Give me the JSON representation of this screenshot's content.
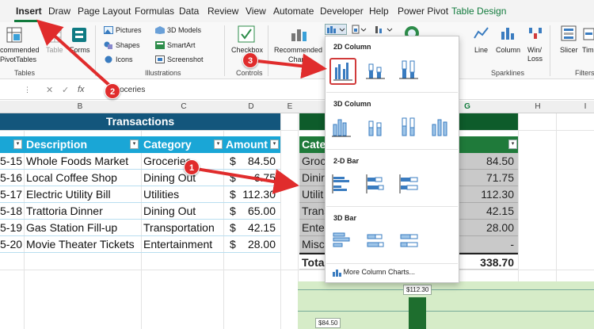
{
  "menu": {
    "tabs": [
      "Insert",
      "Draw",
      "Page Layout",
      "Formulas",
      "Data",
      "Review",
      "View",
      "Automate",
      "Developer",
      "Help",
      "Power Pivot",
      "Table Design"
    ]
  },
  "ribbon": {
    "tables": {
      "recommended": "commended",
      "pivottables": "PivotTables",
      "table": "Table",
      "forms": "Forms",
      "group_label": "Tables"
    },
    "illustrations": {
      "pictures": "Pictures",
      "shapes": "Shapes",
      "icons": "Icons",
      "models": "3D Models",
      "smartart": "SmartArt",
      "screenshot": "Screenshot",
      "group_label": "Illustrations"
    },
    "controls": {
      "checkbox": "Checkbox",
      "group_label": "Controls"
    },
    "charts": {
      "recommended": "Recommended",
      "charts": "Charts"
    },
    "sparklines": {
      "line": "Line",
      "column": "Column",
      "winloss": "Win/",
      "winloss2": "Loss",
      "group_label": "Sparklines"
    },
    "filters": {
      "slicer": "Slicer",
      "timeline": "Tim",
      "group_label": "Filters"
    }
  },
  "formula_bar": {
    "fx": "fx",
    "content": "Groceries"
  },
  "columns": [
    "B",
    "C",
    "D",
    "E",
    "G",
    "H",
    "I"
  ],
  "transactions": {
    "title": "Transactions",
    "headers": {
      "description": "Description",
      "category": "Category",
      "amount": "Amount"
    },
    "rows": [
      {
        "date": "5-15",
        "description": "Whole Foods Market",
        "category": "Groceries",
        "cur": "$",
        "amount": "84.50"
      },
      {
        "date": "5-16",
        "description": "Local Coffee Shop",
        "category": "Dining Out",
        "cur": "$",
        "amount": "6.75"
      },
      {
        "date": "5-17",
        "description": "Electric Utility Bill",
        "category": "Utilities",
        "cur": "$",
        "amount": "112.30"
      },
      {
        "date": "5-18",
        "description": "Trattoria Dinner",
        "category": "Dining Out",
        "cur": "$",
        "amount": "65.00"
      },
      {
        "date": "5-19",
        "description": "Gas Station Fill-up",
        "category": "Transportation",
        "cur": "$",
        "amount": "42.15"
      },
      {
        "date": "5-20",
        "description": "Movie Theater Tickets",
        "category": "Entertainment",
        "cur": "$",
        "amount": "28.00"
      }
    ]
  },
  "summary": {
    "header": "Cate",
    "rows": [
      {
        "cat": "Groc",
        "val": "84.50"
      },
      {
        "cat": "Dinir",
        "val": "71.75"
      },
      {
        "cat": "Utilit",
        "val": "112.30"
      },
      {
        "cat": "Trans",
        "val": "42.15"
      },
      {
        "cat": "Enter",
        "val": "28.00"
      },
      {
        "cat": "Misc",
        "val": "-"
      }
    ],
    "total_label": "Tota",
    "total_value": "338.70"
  },
  "chart_preview": {
    "label_high": "$112.30",
    "label_low": "$84.50"
  },
  "dropdown": {
    "section_2d_column": "2D Column",
    "section_3d_column": "3D Column",
    "section_2d_bar": "2-D Bar",
    "section_3d_bar": "3D Bar",
    "more": "More Column Charts..."
  },
  "annotations": {
    "badge1": "1",
    "badge2": "2",
    "badge3": "3"
  },
  "colors": {
    "accent": "#117a3c",
    "table_blue": "#1aa6d6",
    "title_blue": "#13567c",
    "summary_green": "#1f7a3a",
    "arrow_red": "#e02c2c"
  }
}
